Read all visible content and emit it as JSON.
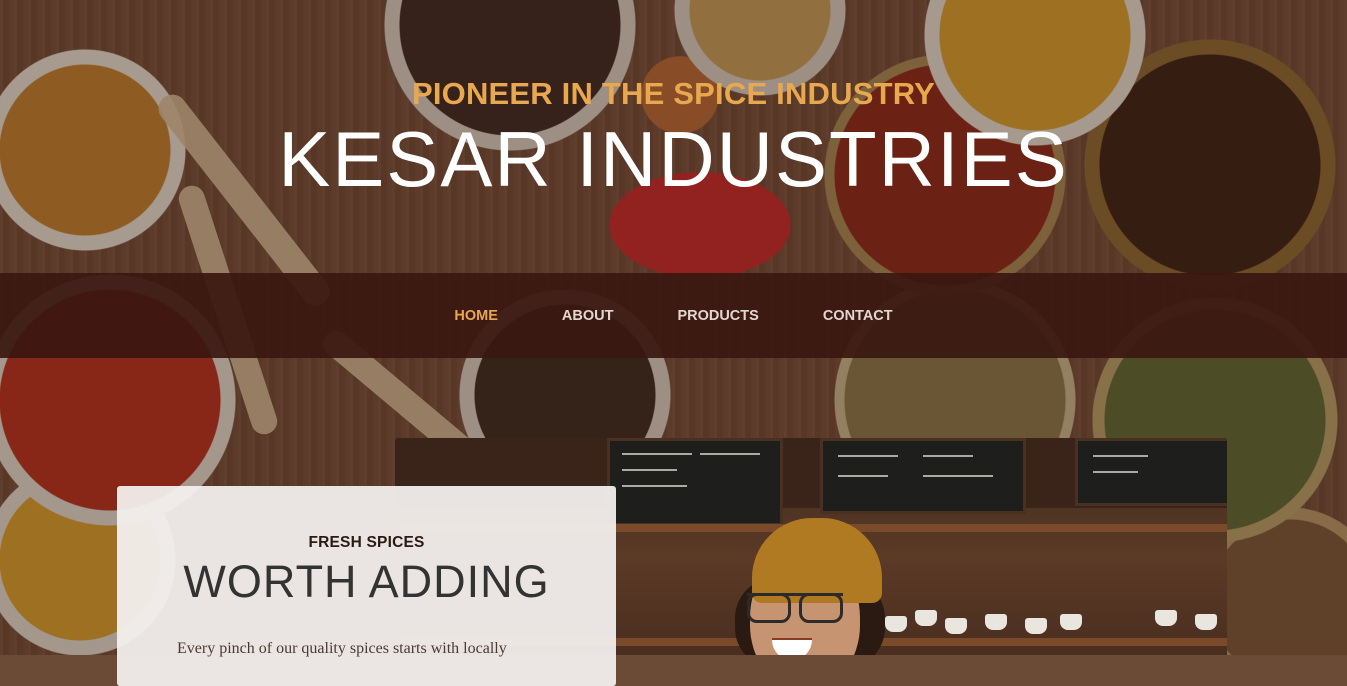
{
  "hero": {
    "subtitle": "PIONEER IN THE SPICE INDUSTRY",
    "title": "KESAR INDUSTRIES"
  },
  "nav": {
    "items": [
      {
        "label": "HOME",
        "active": true
      },
      {
        "label": "ABOUT",
        "active": false
      },
      {
        "label": "PRODUCTS",
        "active": false
      },
      {
        "label": "CONTACT",
        "active": false
      }
    ]
  },
  "intro": {
    "subtitle": "FRESH SPICES",
    "title": "WORTH ADDING",
    "text": "Every pinch of our quality spices starts with locally"
  },
  "colors": {
    "accent": "#e8a84f",
    "nav_background": "#3a1811",
    "card_background": "#f3f0ee"
  }
}
